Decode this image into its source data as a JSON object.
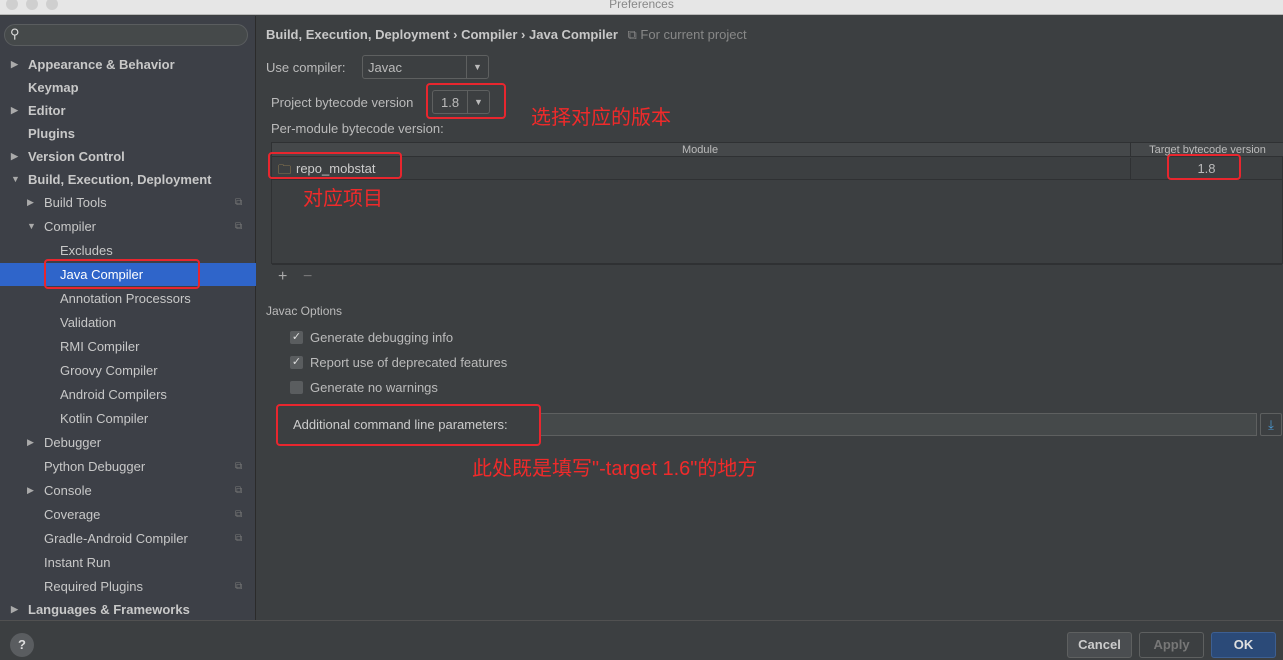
{
  "window": {
    "title": "Preferences"
  },
  "sidebar": {
    "search_placeholder": "",
    "items": [
      {
        "label": "Appearance & Behavior"
      },
      {
        "label": "Keymap"
      },
      {
        "label": "Editor"
      },
      {
        "label": "Plugins"
      },
      {
        "label": "Version Control"
      },
      {
        "label": "Build, Execution, Deployment"
      },
      {
        "label": "Build Tools"
      },
      {
        "label": "Compiler"
      },
      {
        "label": "Excludes"
      },
      {
        "label": "Java Compiler"
      },
      {
        "label": "Annotation Processors"
      },
      {
        "label": "Validation"
      },
      {
        "label": "RMI Compiler"
      },
      {
        "label": "Groovy Compiler"
      },
      {
        "label": "Android Compilers"
      },
      {
        "label": "Kotlin Compiler"
      },
      {
        "label": "Debugger"
      },
      {
        "label": "Python Debugger"
      },
      {
        "label": "Console"
      },
      {
        "label": "Coverage"
      },
      {
        "label": "Gradle-Android Compiler"
      },
      {
        "label": "Instant Run"
      },
      {
        "label": "Required Plugins"
      },
      {
        "label": "Languages & Frameworks"
      }
    ]
  },
  "breadcrumb": {
    "part1": "Build, Execution, Deployment",
    "part2": "Compiler",
    "part3": "Java Compiler",
    "sep": "›",
    "scope": "For current project"
  },
  "compiler": {
    "label": "Use compiler:",
    "value": "Javac"
  },
  "bytecode": {
    "label": "Project bytecode version",
    "value": "1.8"
  },
  "per_module": {
    "label": "Per-module bytecode version:",
    "col_module": "Module",
    "col_target": "Target bytecode version",
    "rows": [
      {
        "module": "repo_mobstat",
        "target": "1.8"
      }
    ],
    "add": "+",
    "remove": "−"
  },
  "javac": {
    "section": "Javac Options",
    "options": [
      {
        "label": "Generate debugging info",
        "checked": true
      },
      {
        "label": "Report use of deprecated features",
        "checked": true
      },
      {
        "label": "Generate no warnings",
        "checked": false
      }
    ],
    "params_label": "Additional command line parameters:",
    "params_value": ""
  },
  "annotations": {
    "version": "选择对应的版本",
    "project": "对应项目",
    "params": "此处既是填写\"-target 1.6\"的地方"
  },
  "buttons": {
    "help": "?",
    "cancel": "Cancel",
    "apply": "Apply",
    "ok": "OK"
  },
  "colors": {
    "selection": "#2f65ca",
    "annotation": "#e8262e",
    "ok": "#2b4a78"
  }
}
